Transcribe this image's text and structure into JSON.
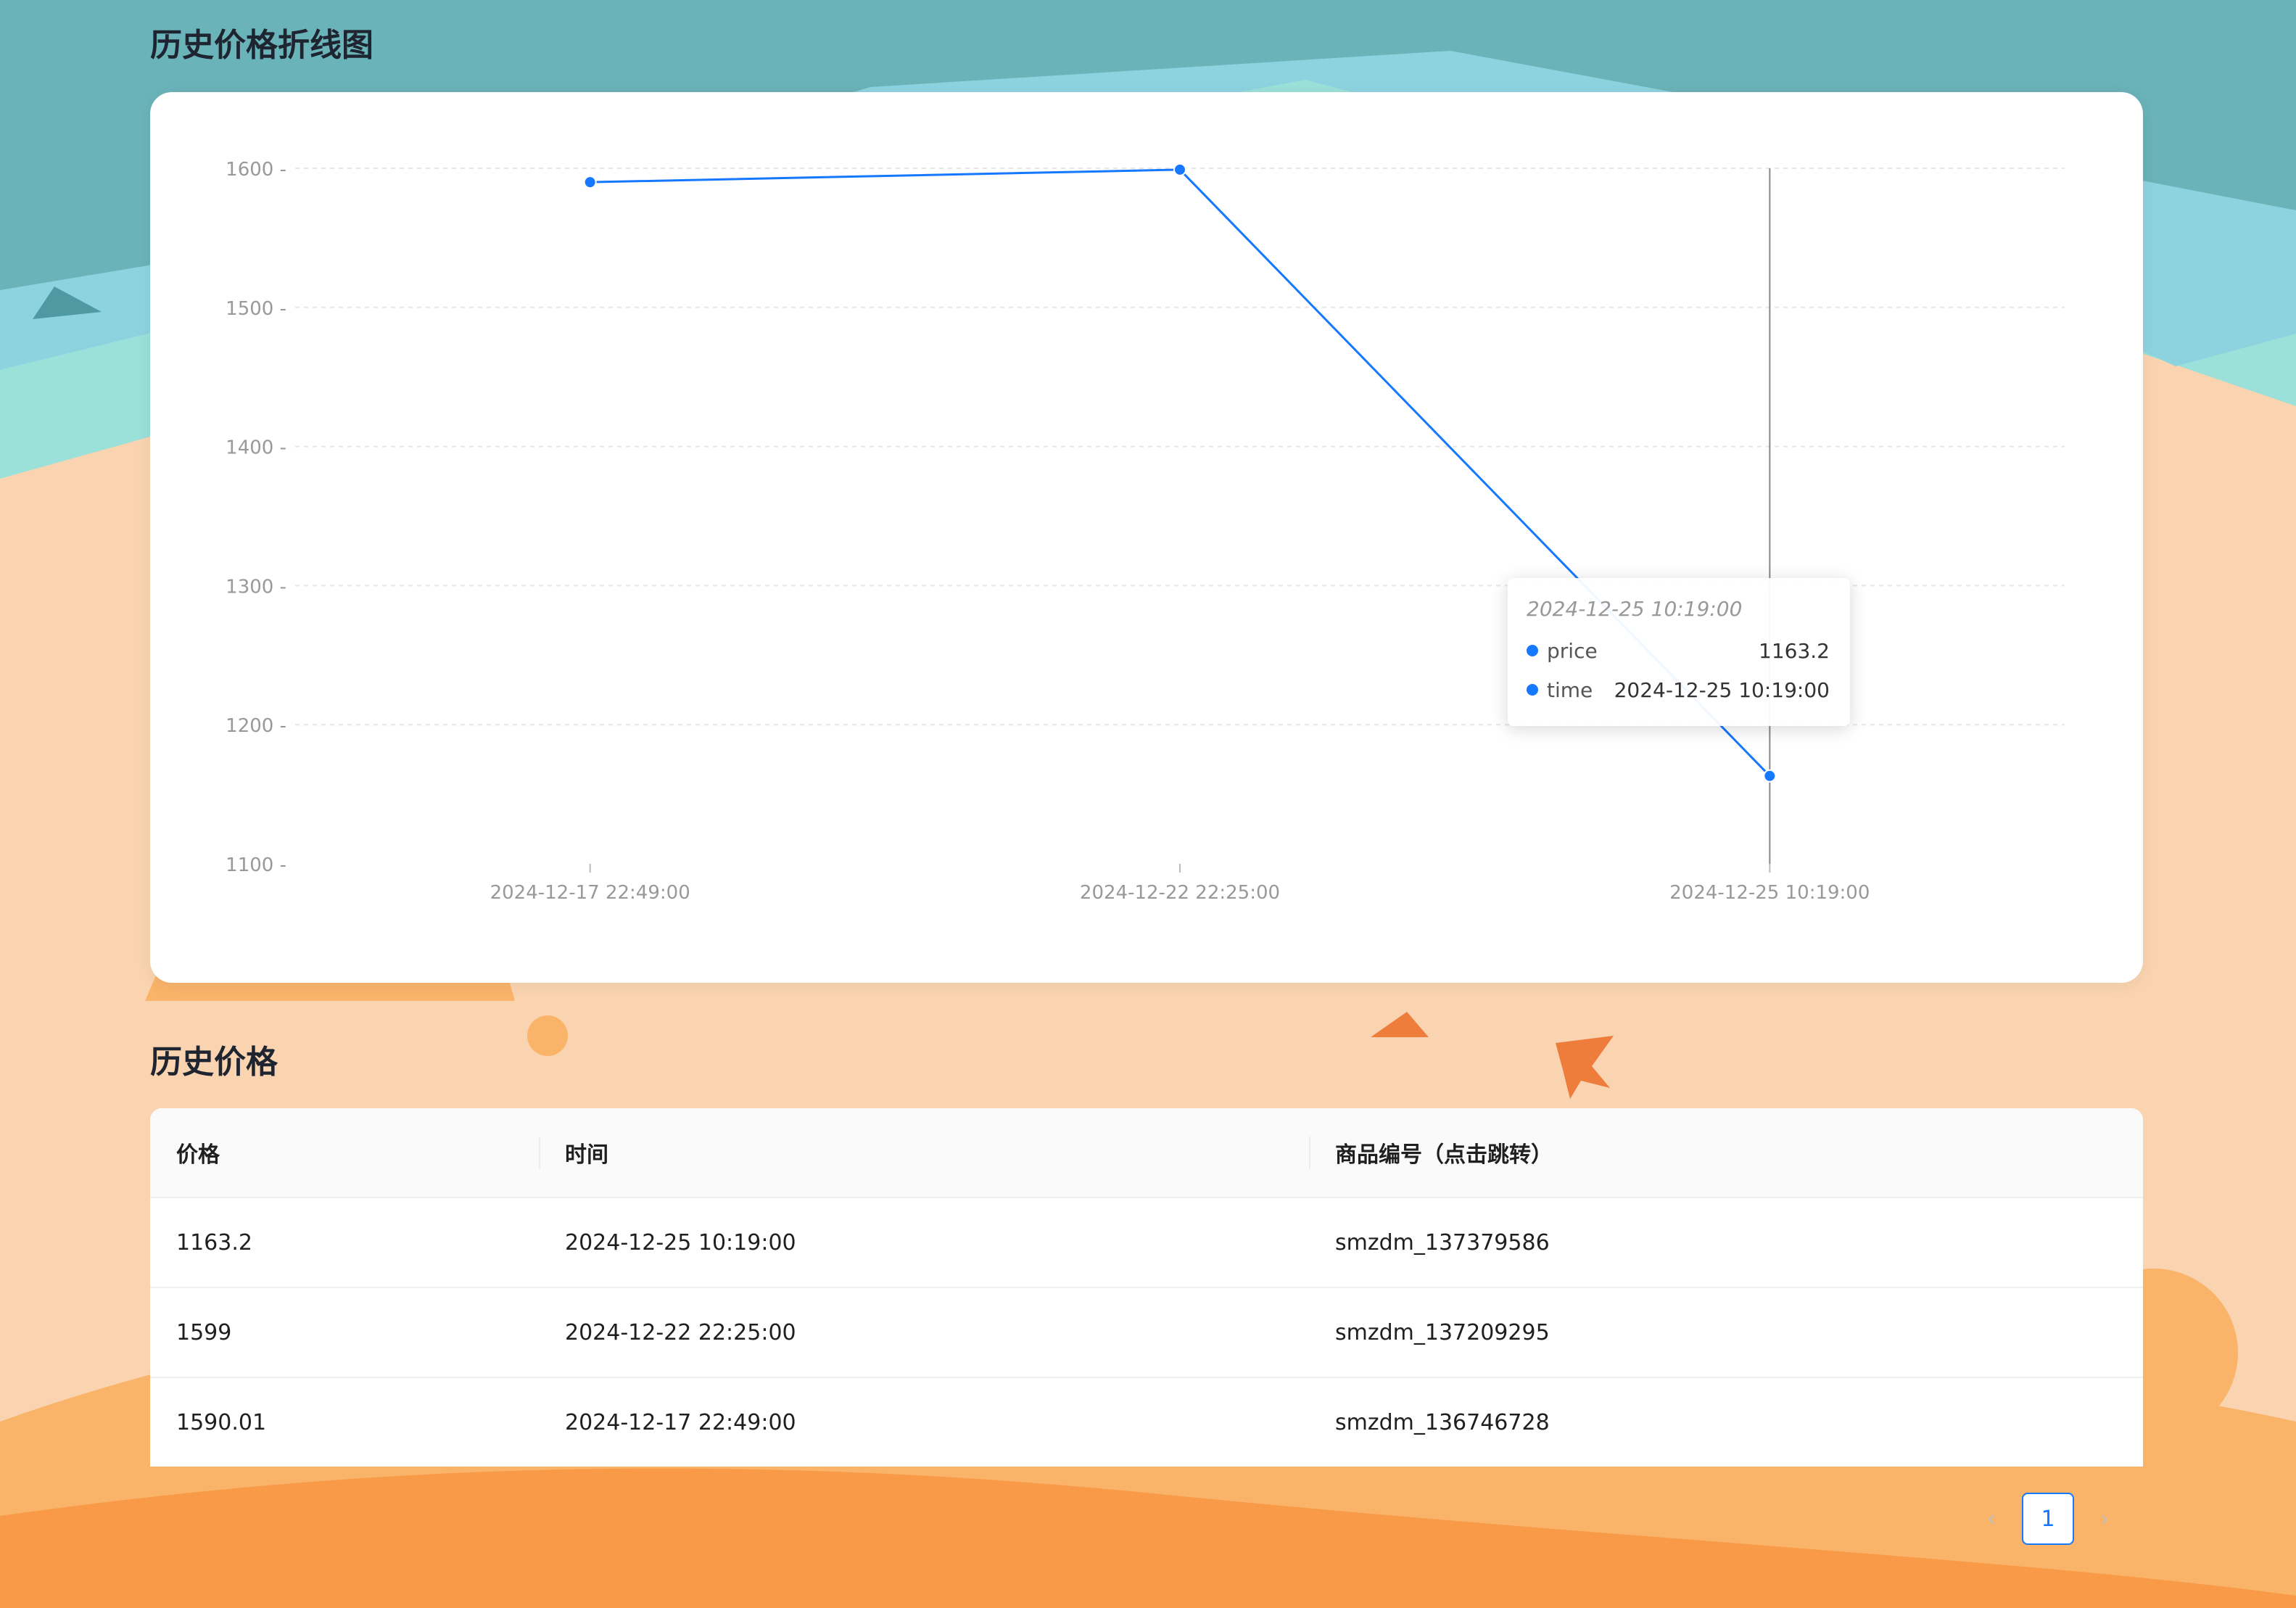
{
  "chart_section": {
    "title": "历史价格折线图"
  },
  "table_section": {
    "title": "历史价格"
  },
  "chart_data": {
    "type": "line",
    "x": [
      "2024-12-17 22:49:00",
      "2024-12-22 22:25:00",
      "2024-12-25 10:19:00"
    ],
    "series": [
      {
        "values": [
          1590.01,
          1599,
          1163.2
        ]
      }
    ],
    "ylim": [
      1100,
      1600
    ],
    "yticks": [
      1100,
      1200,
      1300,
      1400,
      1500,
      1600
    ],
    "grid": true,
    "color": "#1677ff",
    "active_index": 2
  },
  "tooltip": {
    "title": "2024-12-25 10:19:00",
    "rows": [
      {
        "name": "price",
        "value": "1163.2"
      },
      {
        "name": "time",
        "value": "2024-12-25 10:19:00"
      }
    ]
  },
  "table": {
    "columns": [
      "价格",
      "时间",
      "商品编号（点击跳转）"
    ],
    "rows": [
      {
        "price": "1163.2",
        "time": "2024-12-25 10:19:00",
        "id": "smzdm_137379586"
      },
      {
        "price": "1599",
        "time": "2024-12-22 22:25:00",
        "id": "smzdm_137209295"
      },
      {
        "price": "1590.01",
        "time": "2024-12-17 22:49:00",
        "id": "smzdm_136746728"
      }
    ]
  },
  "pagination": {
    "current": "1",
    "prev_icon": "chevron-left-icon",
    "next_icon": "chevron-right-icon"
  },
  "colors": {
    "accent": "#1677ff",
    "sea": "#6ab3b8",
    "sand": "#fad4b0",
    "dune": "#f99a48"
  }
}
